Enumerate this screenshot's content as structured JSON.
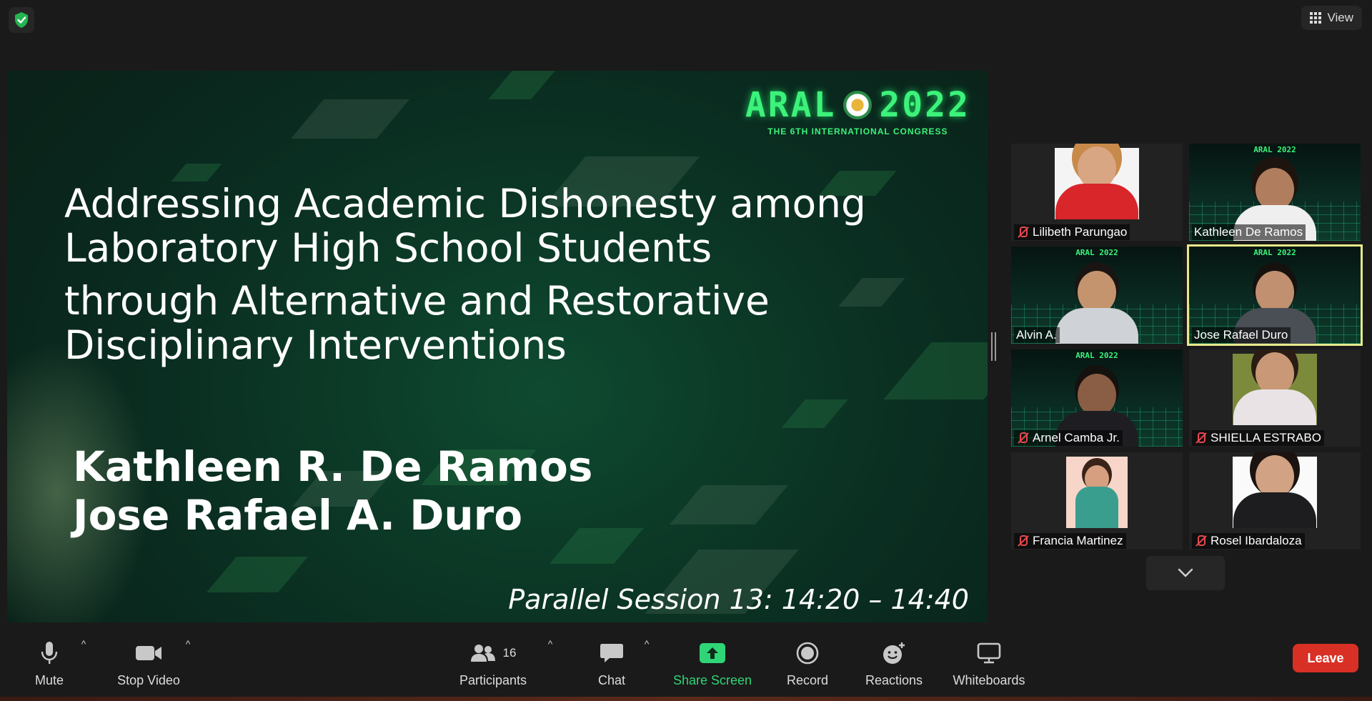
{
  "top": {
    "security_icon": "shield-check-icon",
    "view_label": "View"
  },
  "slide": {
    "logo_text_left": "ARAL",
    "logo_text_right": "2022",
    "logo_subtitle": "THE 6TH INTERNATIONAL CONGRESS",
    "title_line1": "Addressing Academic Dishonesty among",
    "title_line2": "Laboratory High School Students",
    "title_line3": "through Alternative and Restorative",
    "title_line4": "Disciplinary Interventions",
    "author1": "Kathleen R. De Ramos",
    "author2": "Jose Rafael A. Duro",
    "session": "Parallel Session 13: 14:20 – 14:40"
  },
  "gallery": {
    "tiles": [
      {
        "name": "Lilibeth Parungao",
        "muted": true
      },
      {
        "name": "Kathleen De Ramos",
        "muted": false
      },
      {
        "name": "Alvin A.",
        "muted": false
      },
      {
        "name": "Jose Rafael Duro",
        "muted": false,
        "active_speaker": true
      },
      {
        "name": "Arnel Camba Jr.",
        "muted": true
      },
      {
        "name": "SHIELLA ESTRABO",
        "muted": true
      },
      {
        "name": "Francia Martinez",
        "muted": true
      },
      {
        "name": "Rosel Ibardaloza",
        "muted": true
      }
    ],
    "mini_logo": "ARAL 2022"
  },
  "toolbar": {
    "mute": "Mute",
    "stop_video": "Stop Video",
    "participants": "Participants",
    "participants_count": "16",
    "chat": "Chat",
    "share_screen": "Share Screen",
    "record": "Record",
    "reactions": "Reactions",
    "whiteboards": "Whiteboards",
    "leave": "Leave"
  },
  "colors": {
    "accent_green": "#2fd576",
    "leave_red": "#d93025",
    "active_speaker_outline": "#e7e98a",
    "slide_logo_green": "#3cf27a"
  }
}
